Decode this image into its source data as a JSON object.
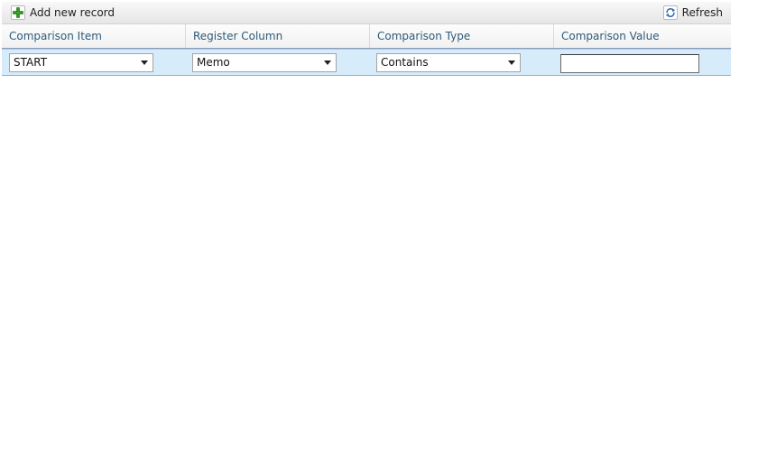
{
  "toolbar": {
    "add_label": "Add new record",
    "add_icon": "plus-icon",
    "refresh_label": "Refresh",
    "refresh_icon": "refresh-icon"
  },
  "columns": [
    "Comparison Item",
    "Register Column",
    "Comparison Type",
    "Comparison Value"
  ],
  "row": {
    "comparison_item": "START",
    "register_column": "Memo",
    "comparison_type": "Contains",
    "comparison_value": ""
  },
  "colors": {
    "header_text": "#2d5a7a",
    "row_background": "#d6ecfa",
    "add_icon": "#2e9a1e",
    "refresh_icon": "#2f6db5"
  }
}
